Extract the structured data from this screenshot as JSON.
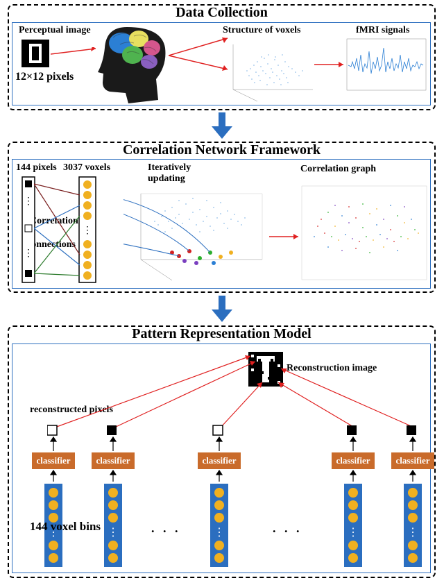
{
  "panel1": {
    "title": "Data Collection",
    "perceptual_label": "Perceptual image",
    "pixels_label": "12×12 pixels",
    "voxel_struct_label": "Structure of voxels",
    "fmri_label": "fMRI signals"
  },
  "panel2": {
    "title": "Correlation Network Framework",
    "pixels_col": "144 pixels",
    "voxels_col": "3037 voxels",
    "iterative": "Iteratively updating",
    "corr_graph": "Correlation  graph",
    "corr_label": "Correlation",
    "conn_label": "connections"
  },
  "panel3": {
    "title": "Pattern Representation Model",
    "recon_img": "Reconstruction image",
    "recon_pixels": "reconstructed  pixels",
    "classifier": "classifier",
    "bins": "144 voxel bins",
    "ellipsis": ". . ."
  }
}
